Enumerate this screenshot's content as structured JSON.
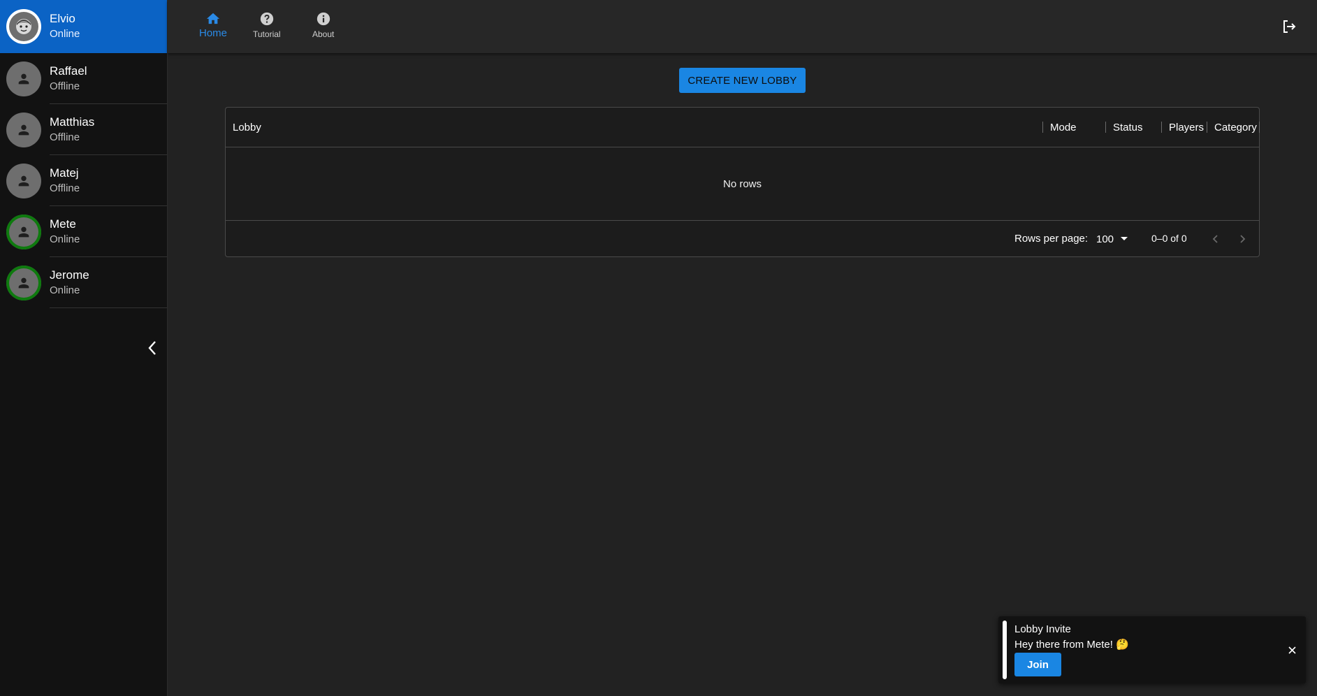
{
  "sidebar": {
    "users": [
      {
        "name": "Elvio",
        "status": "Online",
        "avatar_icon": "face-avatar-icon"
      },
      {
        "name": "Raffael",
        "status": "Offline",
        "avatar_icon": "person-icon"
      },
      {
        "name": "Matthias",
        "status": "Offline",
        "avatar_icon": "person-icon"
      },
      {
        "name": "Matej",
        "status": "Offline",
        "avatar_icon": "person-icon"
      },
      {
        "name": "Mete",
        "status": "Online",
        "avatar_icon": "person-icon"
      },
      {
        "name": "Jerome",
        "status": "Online",
        "avatar_icon": "person-icon"
      }
    ],
    "collapse_icon": "chevron-left-icon"
  },
  "nav": {
    "items": [
      {
        "label": "Home",
        "icon": "home-icon",
        "active": true
      },
      {
        "label": "Tutorial",
        "icon": "help-circle-icon",
        "active": false
      },
      {
        "label": "About",
        "icon": "info-icon",
        "active": false
      }
    ],
    "logout_icon": "logout-icon"
  },
  "main": {
    "create_lobby_label": "CREATE NEW LOBBY",
    "grid": {
      "columns": [
        "Lobby",
        "Mode",
        "Status",
        "Players",
        "Category"
      ],
      "empty_text": "No rows",
      "rows_per_page_label": "Rows per page:",
      "rows_per_page_value": "100",
      "page_range": "0–0 of 0"
    }
  },
  "toast": {
    "title": "Lobby Invite",
    "message": "Hey there from Mete! 🤔",
    "join_label": "Join"
  },
  "colors": {
    "accent": "#1a86e3",
    "sidebar_active": "#0b63c5",
    "online_ring": "#0e7a0e",
    "background": "#222222"
  }
}
